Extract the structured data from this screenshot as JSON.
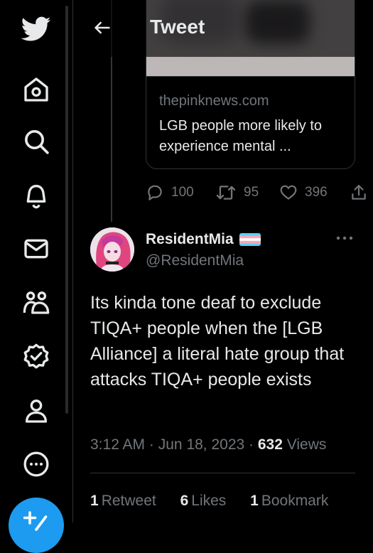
{
  "header": {
    "title": "Tweet"
  },
  "card": {
    "domain": "thepinknews.com",
    "title": "LGB people more likely to experience mental ..."
  },
  "actions": {
    "replies": "100",
    "retweets": "95",
    "likes": "396"
  },
  "tweet": {
    "display_name": "ResidentMia",
    "handle": "@ResidentMia",
    "text": "Its kinda tone deaf  to exclude TIQA+ people when the [LGB Alliance] a literal hate group that attacks TIQA+ people exists",
    "time": "3:12 AM",
    "date": "Jun 18, 2023",
    "views_count": "632",
    "views_label": "Views",
    "separator": "·"
  },
  "stats": {
    "retweets_count": "1",
    "retweets_label": "Retweet",
    "likes_count": "6",
    "likes_label": "Likes",
    "bookmarks_count": "1",
    "bookmarks_label": "Bookmark"
  },
  "nav": {
    "icons": [
      "twitter-logo-icon",
      "home-icon",
      "search-icon",
      "notifications-icon",
      "messages-icon",
      "communities-icon",
      "verified-icon",
      "profile-icon",
      "more-icon",
      "compose-icon"
    ]
  },
  "colors": {
    "accent": "#1d9bf0",
    "text": "#e7e9ea",
    "muted": "#71767b",
    "border": "#2f3336",
    "background": "#000000"
  }
}
